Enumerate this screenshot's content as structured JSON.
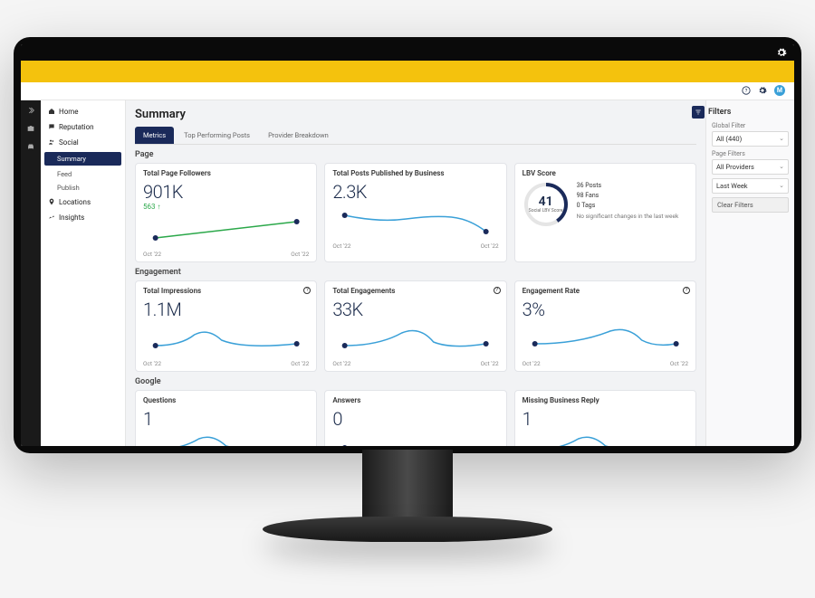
{
  "header": {
    "avatar_letter": "M"
  },
  "nav": {
    "items": [
      {
        "key": "home",
        "label": "Home"
      },
      {
        "key": "reputation",
        "label": "Reputation"
      },
      {
        "key": "social",
        "label": "Social"
      },
      {
        "key": "locations",
        "label": "Locations"
      },
      {
        "key": "insights",
        "label": "Insights"
      }
    ],
    "social_sub": [
      {
        "label": "Summary",
        "active": true
      },
      {
        "label": "Feed",
        "active": false
      },
      {
        "label": "Publish",
        "active": false
      }
    ]
  },
  "page_title": "Summary",
  "tabs": [
    {
      "label": "Metrics",
      "active": true
    },
    {
      "label": "Top Performing Posts",
      "active": false
    },
    {
      "label": "Provider Breakdown",
      "active": false
    }
  ],
  "sections": {
    "page": {
      "label": "Page",
      "cards": {
        "followers": {
          "title": "Total Page Followers",
          "value": "901K",
          "delta": "563",
          "x_start": "Oct '22",
          "x_end": "Oct '22"
        },
        "posts": {
          "title": "Total Posts Published by Business",
          "value": "2.3K",
          "x_start": "Oct '22",
          "x_end": "Oct '22"
        },
        "lbv": {
          "title": "LBV Score",
          "score": "41",
          "sub": "Social LBV Score",
          "stats": {
            "posts": "36 Posts",
            "fans": "98 Fans",
            "tags": "0 Tags"
          },
          "note": "No significant changes in the last week"
        }
      }
    },
    "engagement": {
      "label": "Engagement",
      "cards": {
        "impressions": {
          "title": "Total Impressions",
          "value": "1.1M",
          "x_start": "Oct '22",
          "x_end": "Oct '22"
        },
        "engagements": {
          "title": "Total Engagements",
          "value": "33K",
          "x_start": "Oct '22",
          "x_end": "Oct '22"
        },
        "rate": {
          "title": "Engagement Rate",
          "value": "3%",
          "x_start": "Oct '22",
          "x_end": "Oct '22"
        }
      }
    },
    "google": {
      "label": "Google",
      "cards": {
        "questions": {
          "title": "Questions",
          "value": "1"
        },
        "answers": {
          "title": "Answers",
          "value": "0"
        },
        "missing": {
          "title": "Missing Business Reply",
          "value": "1"
        }
      }
    }
  },
  "filters": {
    "title": "Filters",
    "global_label": "Global Filter",
    "global_value": "All (440)",
    "page_label": "Page Filters",
    "providers_value": "All Providers",
    "range_value": "Last Week",
    "clear": "Clear Filters"
  },
  "colors": {
    "navy": "#1a2a5a",
    "blue": "#3aa0d8",
    "green": "#2ba84a",
    "yellow": "#f4c20d"
  },
  "chart_data": [
    {
      "type": "line",
      "title": "Total Page Followers",
      "x": [
        "Oct '22",
        "Oct '22"
      ],
      "values": [
        880,
        910
      ],
      "ylim": [
        850,
        920
      ],
      "color": "#2ba84a"
    },
    {
      "type": "line",
      "title": "Total Posts Published by Business",
      "x": [
        "Oct '22",
        "",
        "",
        "Oct '22"
      ],
      "values": [
        2.3,
        2.2,
        2.35,
        1.9
      ],
      "ylim": [
        1.7,
        2.5
      ],
      "color": "#3aa0d8"
    },
    {
      "type": "line",
      "title": "Total Impressions",
      "x": [
        "Oct '22",
        "",
        "",
        "",
        "Oct '22"
      ],
      "values": [
        1.0,
        1.0,
        1.3,
        1.0,
        1.05
      ],
      "ylim": [
        0.9,
        1.4
      ],
      "color": "#3aa0d8"
    },
    {
      "type": "line",
      "title": "Total Engagements",
      "x": [
        "Oct '22",
        "",
        "",
        "",
        "Oct '22"
      ],
      "values": [
        30,
        30,
        40,
        30,
        32
      ],
      "ylim": [
        25,
        42
      ],
      "color": "#3aa0d8"
    },
    {
      "type": "line",
      "title": "Engagement Rate",
      "x": [
        "Oct '22",
        "",
        "",
        "",
        "Oct '22"
      ],
      "values": [
        3,
        3,
        3.8,
        3,
        3.1
      ],
      "ylim": [
        2.7,
        4.0
      ],
      "color": "#3aa0d8"
    }
  ]
}
